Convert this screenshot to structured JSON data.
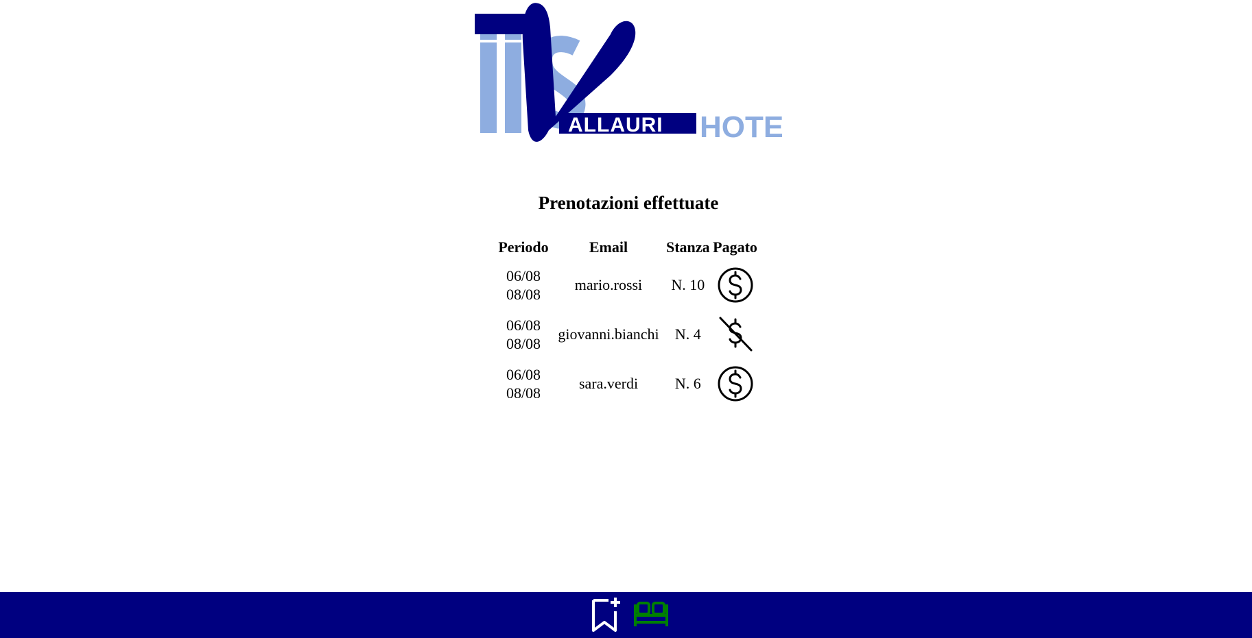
{
  "logo": {
    "alt": "IIS Vallauri Hotel logo",
    "text_main": "ALLAURI",
    "text_hotel": "HOTEL",
    "colors": {
      "dark": "#000080",
      "light": "#8EADE0"
    }
  },
  "page_title": "Prenotazioni effettuate",
  "table": {
    "headers": [
      "Periodo",
      "Email",
      "Stanza",
      "Pagato"
    ],
    "rows": [
      {
        "period_from": "06/08",
        "period_to": "08/08",
        "email": "mario.rossi",
        "room": "N. 10",
        "paid_icon": "dollar-circle-icon"
      },
      {
        "period_from": "06/08",
        "period_to": "08/08",
        "email": "giovanni.bianchi",
        "room": "N. 4",
        "paid_icon": "dollar-off-icon"
      },
      {
        "period_from": "06/08",
        "period_to": "08/08",
        "email": "sara.verdi",
        "room": "N. 6",
        "paid_icon": "dollar-circle-icon"
      }
    ]
  },
  "footer": {
    "background": "#000080",
    "buttons": [
      {
        "icon": "bookmark-plus-icon",
        "color": "#ffffff"
      },
      {
        "icon": "bed-icon",
        "color": "#008000"
      }
    ]
  }
}
